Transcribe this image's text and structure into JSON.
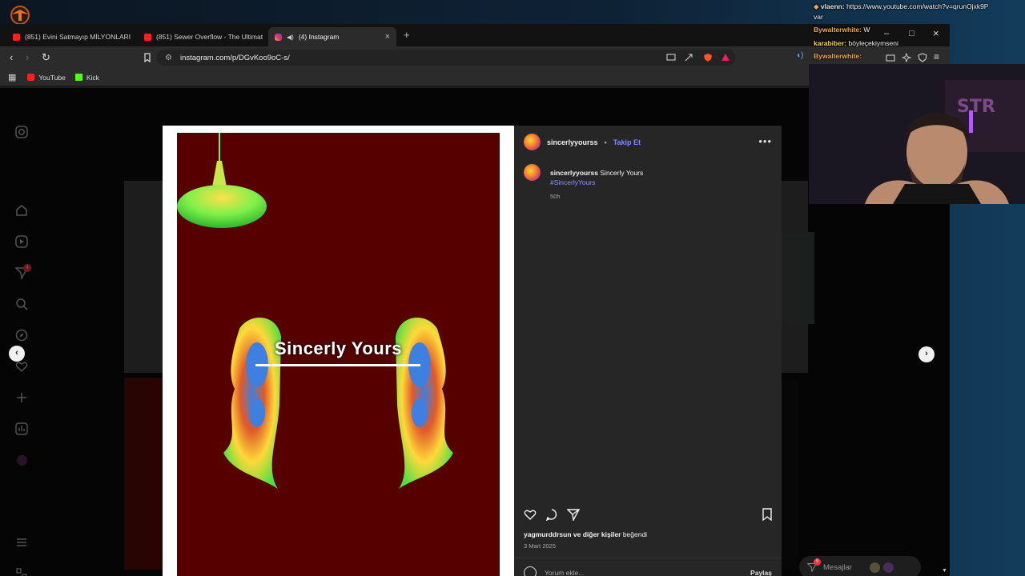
{
  "browser": {
    "tabs": [
      {
        "label": "(851) Evini Satmayıp MİLYONLARI REDDEDEN",
        "icon": "youtube-icon",
        "active": false
      },
      {
        "label": "(851) Sewer Overflow - The Ultimate",
        "icon": "youtube-icon",
        "active": false
      },
      {
        "label": "(4) Instagram",
        "icon": "instagram-icon",
        "active": true
      }
    ],
    "new_tab": "+",
    "url": "instagram.com/p/DGvKoo9oC-s/",
    "bookmarks": [
      {
        "label": "YouTube",
        "icon": "youtube-icon"
      },
      {
        "label": "Kick",
        "icon": "kick-icon"
      }
    ]
  },
  "post": {
    "username": "sincerlyyourss",
    "follow_label": "Takip Et",
    "separator": "•",
    "caption_text": "Sincerly Yours",
    "hashtag": "#SincerlyYours",
    "time_ago": "50h",
    "likes_user": "yagmurddrsun",
    "likes_rest": "ve diğer kişiler",
    "likes_suffix": "beğendi",
    "date": "3 Mart 2025",
    "comment_placeholder": "Yorum ekle...",
    "share_label": "Paylaş",
    "image_title": "Sincerly Yours"
  },
  "sidebar": {
    "notification_badge": "4"
  },
  "messages": {
    "label": "Mesajlar",
    "badge": "9"
  },
  "chat": [
    {
      "user": "vlaenn:",
      "text": "https://www.youtube.com/watch?v=qrunOjxk9P",
      "cont": "var"
    },
    {
      "user": "Bywalterwhite:",
      "text": "W"
    },
    {
      "user": "karabiber:",
      "text": "böyleçekiymseni"
    },
    {
      "user": "Bywalterwhite:",
      "text": ""
    }
  ],
  "colors": {
    "art_background": "#560100",
    "follow_link": "#7f8cff",
    "post_panel": "#262626"
  }
}
